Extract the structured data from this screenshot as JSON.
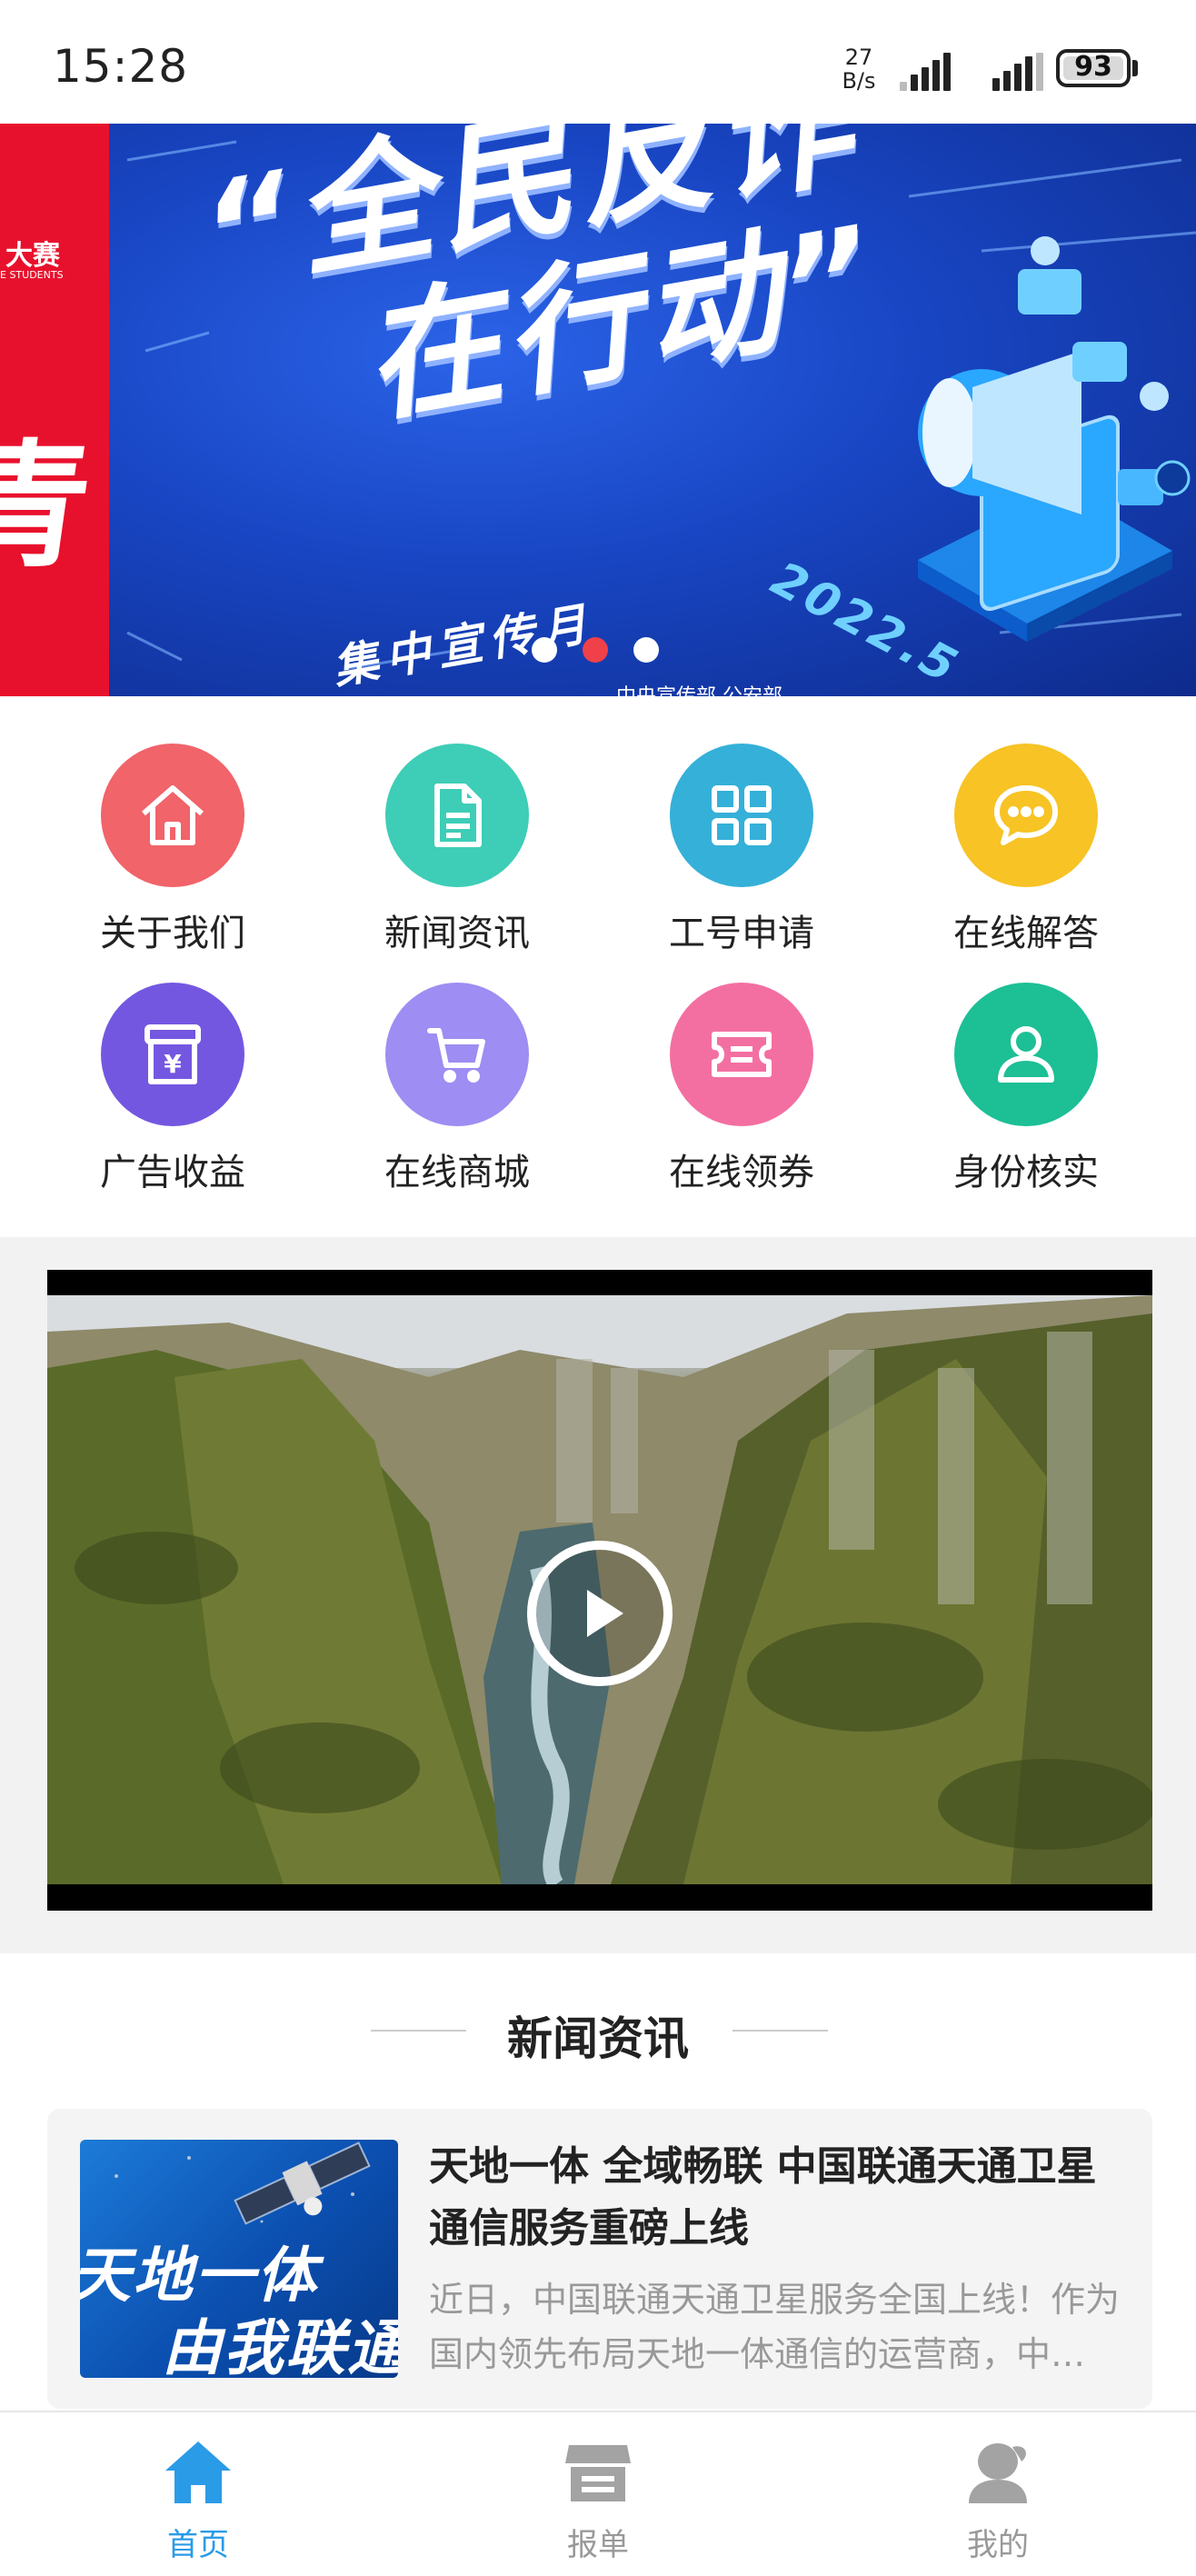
{
  "status_bar": {
    "time": "15:28",
    "net_speed_value": "27",
    "net_speed_unit": "B/s",
    "battery": "93"
  },
  "banner": {
    "side_tag": "大赛",
    "side_tag_sub": "E STUDENTS",
    "side_char": "青",
    "title_line1": "“全民反诈",
    "title_line2": "在行动”",
    "subtitle": "集中宣传月",
    "year": "2022.5",
    "footer": "中央宣传部 公安部",
    "active_dot": 1,
    "dot_count": 3
  },
  "quick_menu": [
    {
      "label": "关于我们",
      "icon": "home-icon",
      "color": "#f0646a"
    },
    {
      "label": "新闻资讯",
      "icon": "document-icon",
      "color": "#3ecdb6"
    },
    {
      "label": "工号申请",
      "icon": "grid-icon",
      "color": "#35b0d8"
    },
    {
      "label": "在线解答",
      "icon": "chat-icon",
      "color": "#f7c325"
    },
    {
      "label": "广告收益",
      "icon": "money-box-icon",
      "color": "#7457e0"
    },
    {
      "label": "在线商城",
      "icon": "cart-icon",
      "color": "#9e8df2"
    },
    {
      "label": "在线领券",
      "icon": "ticket-icon",
      "color": "#f36fa2"
    },
    {
      "label": "身份核实",
      "icon": "person-icon",
      "color": "#1dbf95"
    }
  ],
  "video": {
    "play_icon": "play-icon"
  },
  "news": {
    "heading": "新闻资讯",
    "items": [
      {
        "thumb_line1": "天地一体",
        "thumb_line2": "由我联通",
        "title": "天地一体 全域畅联 中国联通天通卫星通信服务重磅上线",
        "summary": "近日，中国联通天通卫星服务全国上线！作为国内领先布局天地一体通信的运营商，中国联通……"
      }
    ]
  },
  "tabbar": {
    "active_color": "#2a9be7",
    "inactive_color": "#9a9a9a",
    "tabs": [
      {
        "label": "首页",
        "icon": "home-tab-icon"
      },
      {
        "label": "报单",
        "icon": "store-tab-icon"
      },
      {
        "label": "我的",
        "icon": "profile-tab-icon"
      }
    ]
  }
}
